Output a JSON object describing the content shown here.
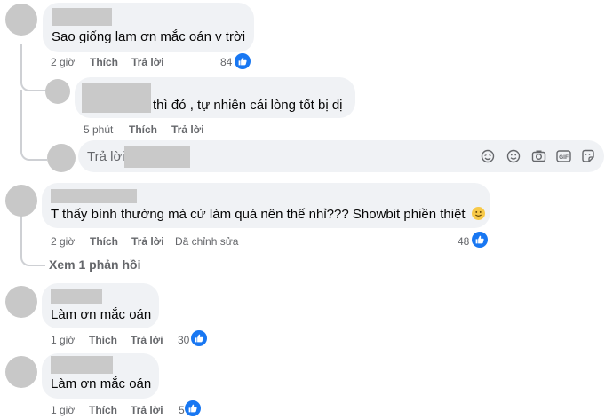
{
  "comments": [
    {
      "text": "Sao giống lam ơn mắc oán v trời",
      "time": "2 giờ",
      "like_label": "Thích",
      "reply_label": "Trả lời",
      "likes": "84"
    },
    {
      "text": "thì đó , tự nhiên cái lòng tốt bị dị",
      "time": "5 phút",
      "like_label": "Thích",
      "reply_label": "Trả lời"
    },
    {
      "text": "T thấy bình thường mà cứ làm quá nên thế nhỉ??? Showbit phiền thiệt",
      "time": "2 giờ",
      "like_label": "Thích",
      "reply_label": "Trả lời",
      "edited_label": "Đã chỉnh sửa",
      "likes": "48"
    },
    {
      "text": "Làm ơn mắc oán",
      "time": "1 giờ",
      "like_label": "Thích",
      "reply_label": "Trả lời",
      "likes": "30"
    },
    {
      "text": "Làm ơn mắc oán",
      "time": "1 giờ",
      "like_label": "Thích",
      "reply_label": "Trả lời",
      "likes": "5"
    }
  ],
  "reply_box": {
    "prefix": "Trả lời"
  },
  "view_replies": "Xem 1 phản hồi",
  "icons": [
    "sticker-face-icon",
    "emoji-icon",
    "camera-icon",
    "gif-icon",
    "sticker-icon"
  ],
  "colors": {
    "like_blue": "#1877f2",
    "bubble": "#f0f2f5",
    "meta": "#65676b"
  }
}
